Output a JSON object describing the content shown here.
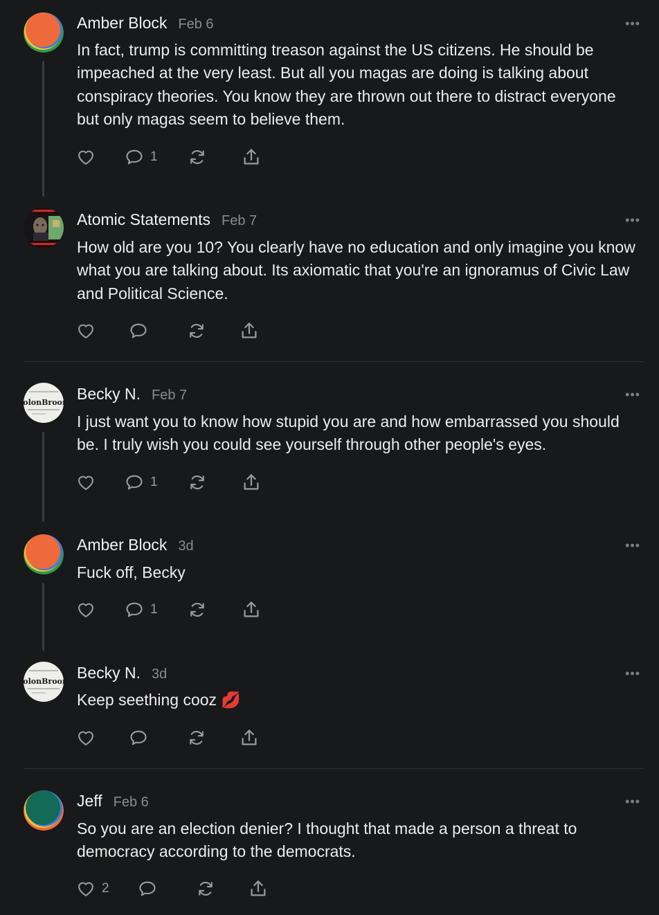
{
  "comments": [
    {
      "author": "Amber Block",
      "date": "Feb 6",
      "text": "In fact, trump is committing treason against the US citizens. He should be impeached at the very least. But all you magas are doing is talking about conspiracy theories. You know they are thrown out there to distract everyone but only magas seem to believe them.",
      "reply_count": "1",
      "like_count": ""
    },
    {
      "author": "Atomic Statements",
      "date": "Feb 7",
      "text": "How old are you 10? You clearly have no education and only imagine you know what you are talking about. Its axiomatic that you're an ignoramus of Civic Law and Political Science.",
      "reply_count": "",
      "like_count": ""
    },
    {
      "author": "Becky N.",
      "date": "Feb 7",
      "text": "I just want you to know how stupid you are and how embarrassed you should be. I truly wish you could see yourself through other people's eyes.",
      "reply_count": "1",
      "like_count": ""
    },
    {
      "author": "Amber Block",
      "date": "3d",
      "text": "Fuck off, Becky",
      "reply_count": "1",
      "like_count": ""
    },
    {
      "author": "Becky N.",
      "date": "3d",
      "text": "Keep seething cooz 💋",
      "reply_count": "",
      "like_count": ""
    },
    {
      "author": "Jeff",
      "date": "Feb 6",
      "text": "So you are an election denier? I thought that made a person a threat to democracy according to the democrats.",
      "reply_count": "",
      "like_count": "2"
    }
  ],
  "avatar_text": {
    "colonbroom": "ColonBroom"
  },
  "more_glyph": "•••",
  "icons": [
    "heart-icon",
    "comment-icon",
    "restack-icon",
    "share-icon",
    "more-icon"
  ],
  "colors": {
    "background": "#18191b",
    "text": "#ececec",
    "muted": "#8a8b8f"
  }
}
